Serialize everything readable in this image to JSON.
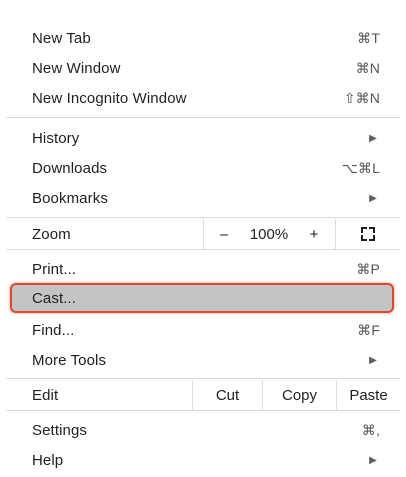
{
  "menu": {
    "new_tab": {
      "label": "New Tab",
      "shortcut": "⌘T"
    },
    "new_window": {
      "label": "New Window",
      "shortcut": "⌘N"
    },
    "new_incognito": {
      "label": "New Incognito Window",
      "shortcut": "⇧⌘N"
    },
    "history": {
      "label": "History"
    },
    "downloads": {
      "label": "Downloads",
      "shortcut": "⌥⌘L"
    },
    "bookmarks": {
      "label": "Bookmarks"
    },
    "zoom": {
      "label": "Zoom",
      "minus": "–",
      "level": "100%",
      "plus": "+"
    },
    "print": {
      "label": "Print...",
      "shortcut": "⌘P"
    },
    "cast": {
      "label": "Cast..."
    },
    "find": {
      "label": "Find...",
      "shortcut": "⌘F"
    },
    "more_tools": {
      "label": "More Tools"
    },
    "edit": {
      "label": "Edit",
      "cut": "Cut",
      "copy": "Copy",
      "paste": "Paste"
    },
    "settings": {
      "label": "Settings",
      "shortcut": "⌘,"
    },
    "help": {
      "label": "Help"
    },
    "submenu_arrow": "▶"
  },
  "colors": {
    "highlight_fill": "#c4c4c4",
    "highlight_border": "#e0472f",
    "divider": "#dcdcdc"
  },
  "icons": {
    "submenu": "chevron-right-icon",
    "fullscreen": "fullscreen-icon"
  }
}
